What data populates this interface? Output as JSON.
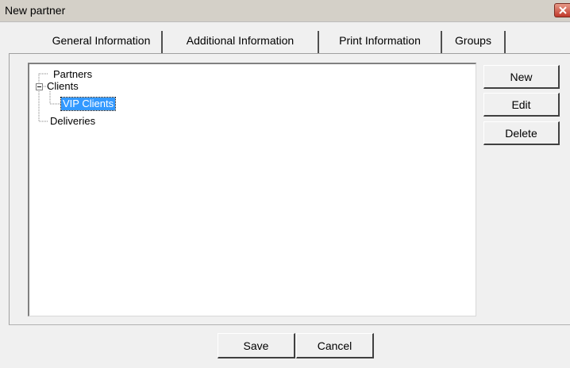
{
  "window": {
    "title": "New partner",
    "close_icon": "close-icon"
  },
  "tabs": [
    {
      "label": "General Information"
    },
    {
      "label": "Additional Information"
    },
    {
      "label": "Print Information"
    },
    {
      "label": "Groups"
    }
  ],
  "tree": {
    "items": [
      {
        "label": "Partners"
      },
      {
        "label": "Clients",
        "expander": "minus-box-icon"
      },
      {
        "label": "VIP Clients",
        "selected": true
      },
      {
        "label": "Deliveries"
      }
    ]
  },
  "side_buttons": {
    "new_label": "New",
    "edit_label": "Edit",
    "delete_label": "Delete"
  },
  "footer": {
    "save_label": "Save",
    "cancel_label": "Cancel"
  },
  "colors": {
    "selection": "#3399ff",
    "close_button": "#c0392b"
  }
}
